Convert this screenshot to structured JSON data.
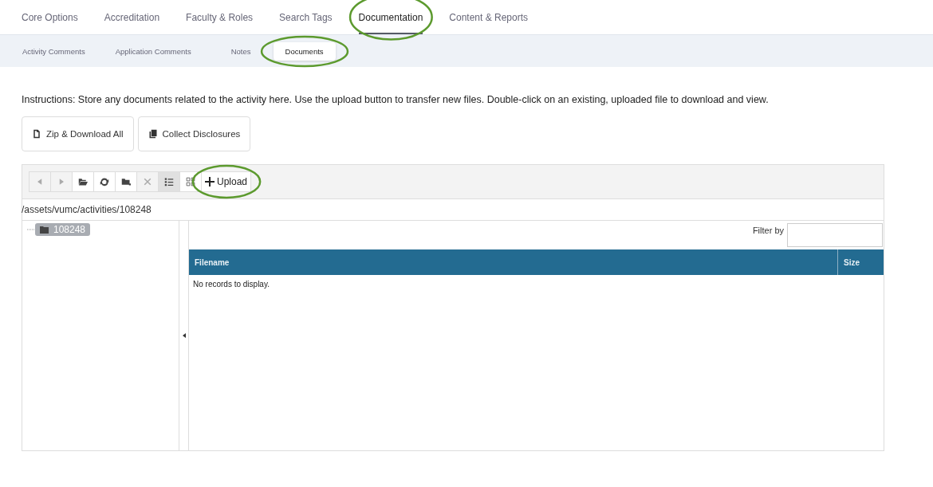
{
  "main_tabs": [
    {
      "label": "Core Options",
      "selected": false,
      "highlighted": false
    },
    {
      "label": "Accreditation",
      "selected": false,
      "highlighted": false
    },
    {
      "label": "Faculty & Roles",
      "selected": false,
      "highlighted": false
    },
    {
      "label": "Search Tags",
      "selected": false,
      "highlighted": false
    },
    {
      "label": "Documentation",
      "selected": true,
      "highlighted": true
    },
    {
      "label": "Content & Reports",
      "selected": false,
      "highlighted": false
    }
  ],
  "sub_tabs": [
    {
      "label": "Activity Comments",
      "selected": false,
      "highlighted": false
    },
    {
      "label": "Application Comments",
      "selected": false,
      "highlighted": false
    },
    {
      "label": "Notes",
      "selected": false,
      "highlighted": false
    },
    {
      "label": "Documents",
      "selected": true,
      "highlighted": true
    }
  ],
  "instructions": "Instructions: Store any documents related to the activity here. Use the upload button to transfer new files. Double-click on an existing, uploaded file to download and view.",
  "actions": [
    {
      "kind": "zip",
      "label": "Zip & Download All"
    },
    {
      "kind": "copy",
      "label": "Collect Disclosures"
    }
  ],
  "toolbar": [
    {
      "kind": "back",
      "disabled": true,
      "selected": false
    },
    {
      "kind": "forward",
      "disabled": true,
      "selected": false
    },
    {
      "kind": "open",
      "disabled": false,
      "selected": false
    },
    {
      "kind": "refresh",
      "disabled": false,
      "selected": false
    },
    {
      "kind": "newfolder",
      "disabled": false,
      "selected": false
    },
    {
      "kind": "delete",
      "disabled": true,
      "selected": false
    },
    {
      "kind": "list",
      "disabled": false,
      "selected": true
    },
    {
      "kind": "grid",
      "disabled": false,
      "selected": false
    }
  ],
  "upload": {
    "label": "Upload",
    "highlighted": true
  },
  "path": "/assets/vumc/activities/108248",
  "tree": [
    {
      "label": "108248",
      "selected": true
    }
  ],
  "filter": {
    "label": "Filter by"
  },
  "table": {
    "columns": [
      "Filename",
      "Size"
    ],
    "empty": "No records to display."
  }
}
